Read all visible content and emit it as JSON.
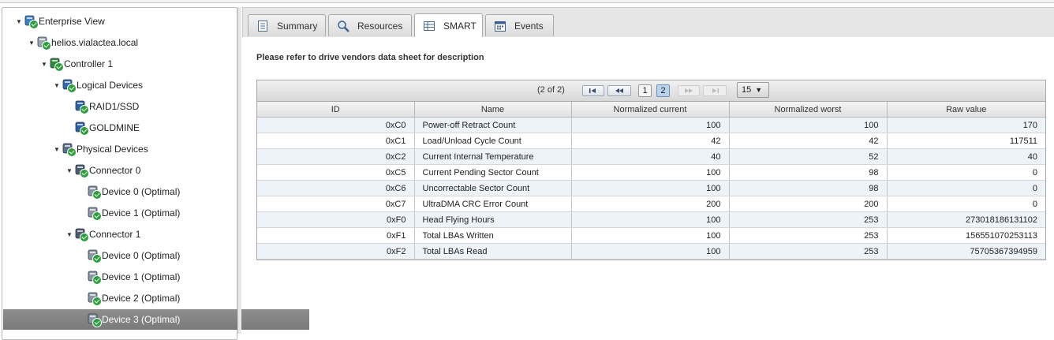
{
  "tree": {
    "items": [
      {
        "label": "Enterprise View",
        "level": 0,
        "expanded": true,
        "icon": "globe-icon"
      },
      {
        "label": "helios.vialactea.local",
        "level": 1,
        "expanded": true,
        "icon": "server-icon"
      },
      {
        "label": "Controller 1",
        "level": 2,
        "expanded": true,
        "icon": "controller-icon"
      },
      {
        "label": "Logical Devices",
        "level": 3,
        "expanded": true,
        "icon": "logical-devices-icon"
      },
      {
        "label": "RAID1/SSD",
        "level": 4,
        "expanded": null,
        "icon": "logical-drive-icon"
      },
      {
        "label": "GOLDMINE",
        "level": 4,
        "expanded": null,
        "icon": "logical-drive-icon"
      },
      {
        "label": "Physical Devices",
        "level": 3,
        "expanded": true,
        "icon": "physical-devices-icon"
      },
      {
        "label": "Connector 0",
        "level": 4,
        "expanded": true,
        "icon": "connector-icon"
      },
      {
        "label": "Device 0 (Optimal)",
        "level": 5,
        "expanded": null,
        "icon": "disk-icon"
      },
      {
        "label": "Device 1 (Optimal)",
        "level": 5,
        "expanded": null,
        "icon": "disk-icon"
      },
      {
        "label": "Connector 1",
        "level": 4,
        "expanded": true,
        "icon": "connector-icon"
      },
      {
        "label": "Device 0 (Optimal)",
        "level": 5,
        "expanded": null,
        "icon": "disk-icon"
      },
      {
        "label": "Device 1 (Optimal)",
        "level": 5,
        "expanded": null,
        "icon": "disk-icon"
      },
      {
        "label": "Device 2 (Optimal)",
        "level": 5,
        "expanded": null,
        "icon": "disk-icon"
      },
      {
        "label": "Device 3 (Optimal)",
        "level": 5,
        "expanded": null,
        "icon": "disk-icon",
        "selected": true
      }
    ]
  },
  "tabs": [
    {
      "label": "Summary",
      "icon": "document-icon",
      "active": false
    },
    {
      "label": "Resources",
      "icon": "magnifier-icon",
      "active": false
    },
    {
      "label": "SMART",
      "icon": "table-icon",
      "active": true
    },
    {
      "label": "Events",
      "icon": "calendar-icon",
      "active": false
    }
  ],
  "notice": "Please refer to drive vendors data sheet for description",
  "paginator": {
    "count_text": "(2 of 2)",
    "pages": [
      "1",
      "2"
    ],
    "current_page": "2",
    "rows_per_page": "15"
  },
  "table": {
    "columns": [
      "ID",
      "Name",
      "Normalized current",
      "Normalized worst",
      "Raw value"
    ],
    "rows": [
      [
        "0xC0",
        "Power-off Retract Count",
        "100",
        "100",
        "170"
      ],
      [
        "0xC1",
        "Load/Unload Cycle Count",
        "42",
        "42",
        "117511"
      ],
      [
        "0xC2",
        "Current Internal Temperature",
        "40",
        "52",
        "40"
      ],
      [
        "0xC5",
        "Current Pending Sector Count",
        "100",
        "98",
        "0"
      ],
      [
        "0xC6",
        "Uncorrectable Sector Count",
        "100",
        "98",
        "0"
      ],
      [
        "0xC7",
        "UltraDMA CRC Error Count",
        "200",
        "200",
        "0"
      ],
      [
        "0xF0",
        "Head Flying Hours",
        "100",
        "253",
        "273018186131102"
      ],
      [
        "0xF1",
        "Total LBAs Written",
        "100",
        "253",
        "156551070253113"
      ],
      [
        "0xF2",
        "Total LBAs Read",
        "100",
        "253",
        "75705367394959"
      ]
    ]
  },
  "colors": {
    "selected_row": "#848484",
    "status_ok": "#2e9e3c",
    "odd_row": "#eef3f9",
    "active_page": "#b9d3ee"
  }
}
